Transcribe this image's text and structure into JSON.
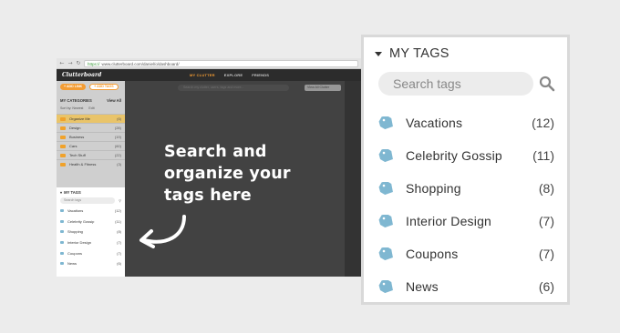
{
  "browser": {
    "url_secure": "https://",
    "url": "www.clutterboard.com/daniel/o/dashboard/",
    "app_logo": "Clutterboard",
    "nav": [
      "MY CLUTTER",
      "EXPLORE",
      "FRIENDS"
    ],
    "search_placeholder": "Search my clutter, users, tags and more...",
    "filter_label": "View All Clutter",
    "add_link_label": "+ ADD LINK",
    "add_tags_label": "+ ADD TAGS",
    "categories_title": "MY CATEGORIES",
    "view_all": "View All",
    "sort_label": "Sort by: Newest",
    "edit_label": "Edit",
    "categories": [
      {
        "name": "Organize Me",
        "count": "(6)"
      },
      {
        "name": "Design",
        "count": "(28)"
      },
      {
        "name": "Business",
        "count": "(19)"
      },
      {
        "name": "Cars",
        "count": "(60)"
      },
      {
        "name": "Tech Stuff",
        "count": "(22)"
      },
      {
        "name": "Health & Fitness",
        "count": "(3)"
      }
    ],
    "mini_tags_title": "MY TAGS",
    "mini_search_placeholder": "Search tags",
    "mini_tags": [
      {
        "name": "Vacations",
        "count": "(12)"
      },
      {
        "name": "Celebrity Gossip",
        "count": "(11)"
      },
      {
        "name": "Shopping",
        "count": "(8)"
      },
      {
        "name": "Interior Design",
        "count": "(7)"
      },
      {
        "name": "Coupons",
        "count": "(7)"
      },
      {
        "name": "News",
        "count": "(6)"
      }
    ]
  },
  "callout": {
    "lines": [
      "Search and",
      "organize your",
      "tags here"
    ]
  },
  "tags_panel": {
    "title": "MY TAGS",
    "search_placeholder": "Search tags",
    "tags": [
      {
        "name": "Vacations",
        "count": "(12)"
      },
      {
        "name": "Celebrity Gossip",
        "count": "(11)"
      },
      {
        "name": "Shopping",
        "count": "(8)"
      },
      {
        "name": "Interior Design",
        "count": "(7)"
      },
      {
        "name": "Coupons",
        "count": "(7)"
      },
      {
        "name": "News",
        "count": "(6)"
      }
    ]
  },
  "colors": {
    "background": "#ececec",
    "accent": "#f39c33",
    "tag_icon": "#7fb7d1",
    "panel_border": "#d9d9d9"
  },
  "icons": [
    "tag-icon",
    "search-icon",
    "caret-down-icon",
    "curved-arrow-icon",
    "folder-icon"
  ]
}
